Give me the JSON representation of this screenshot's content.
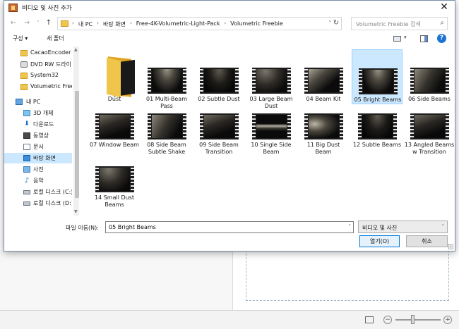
{
  "dialog": {
    "title": "비디오 및 사진 추가",
    "close_glyph": "✕"
  },
  "nav": {
    "back_glyph": "←",
    "forward_glyph": "→",
    "recent_glyph": "˅",
    "up_glyph": "↑",
    "refresh_glyph": "↻",
    "address_dropdown_glyph": "˅",
    "breadcrumbs": [
      "내 PC",
      "바탕 화면",
      "Free-4K-Volumetric-Light-Pack",
      "Volumetric Freebie"
    ],
    "crumb_separator": "›",
    "search_placeholder": "Volumetric Freebie 검색",
    "search_glyph": "⌕"
  },
  "commands": {
    "organize": "구성 ▾",
    "new_folder": "새 폴더",
    "view_dropdown_glyph": "▾",
    "help_glyph": "?"
  },
  "sidebar": {
    "items": [
      {
        "label": "CacaoEncoder",
        "icon": "folder-icon"
      },
      {
        "label": "DVD RW 드라이",
        "icon": "dvd-drive-icon"
      },
      {
        "label": "System32",
        "icon": "folder-icon"
      },
      {
        "label": "Volumetric Free",
        "icon": "folder-icon"
      },
      {
        "label": "내 PC",
        "icon": "pc-icon"
      },
      {
        "label": "3D 개체",
        "icon": "3d-objects-icon"
      },
      {
        "label": "다운로드",
        "icon": "download-icon"
      },
      {
        "label": "동영상",
        "icon": "videos-icon"
      },
      {
        "label": "문서",
        "icon": "documents-icon"
      },
      {
        "label": "바탕 화면",
        "icon": "desktop-icon"
      },
      {
        "label": "사진",
        "icon": "pictures-icon"
      },
      {
        "label": "음악",
        "icon": "music-icon"
      },
      {
        "label": "로컬 디스크 (C:)",
        "icon": "drive-icon"
      },
      {
        "label": "로컬 디스크 (D:)",
        "icon": "drive-icon"
      }
    ],
    "selected": "바탕 화면",
    "scroll_up_glyph": "▲",
    "scroll_down_glyph": "▼"
  },
  "files": {
    "items": [
      {
        "name": "Dust",
        "type": "folder"
      },
      {
        "name": "01 Multi-Beam Pass",
        "type": "video"
      },
      {
        "name": "02 Subtle Dust",
        "type": "video"
      },
      {
        "name": "03 Large Beam Dust",
        "type": "video"
      },
      {
        "name": "04 Beam Kit",
        "type": "video"
      },
      {
        "name": "05 Bright Beams",
        "type": "video"
      },
      {
        "name": "06 Side Beams",
        "type": "video"
      },
      {
        "name": "07 Window Beam",
        "type": "video"
      },
      {
        "name": "08 Side Beam Subtle Shake",
        "type": "video"
      },
      {
        "name": "09 Side Beam Transition",
        "type": "video"
      },
      {
        "name": "10 Single Side Beam",
        "type": "video"
      },
      {
        "name": "11 Big Dust Beam",
        "type": "video"
      },
      {
        "name": "12 Subtle Beams",
        "type": "video"
      },
      {
        "name": "13 Angled Beams w Transition",
        "type": "video"
      },
      {
        "name": "14 Small Dust Beams",
        "type": "video"
      }
    ],
    "selected": "05 Bright Beams"
  },
  "footer": {
    "filename_label": "파일 이름(N):",
    "filename_value": "05 Bright Beams",
    "filetype_value": "비디오 및 사진",
    "dropdown_glyph": "˅",
    "open_label": "열기(O)",
    "cancel_label": "취소"
  },
  "background_app": {
    "zoom_minus": "−",
    "zoom_plus": "+"
  }
}
